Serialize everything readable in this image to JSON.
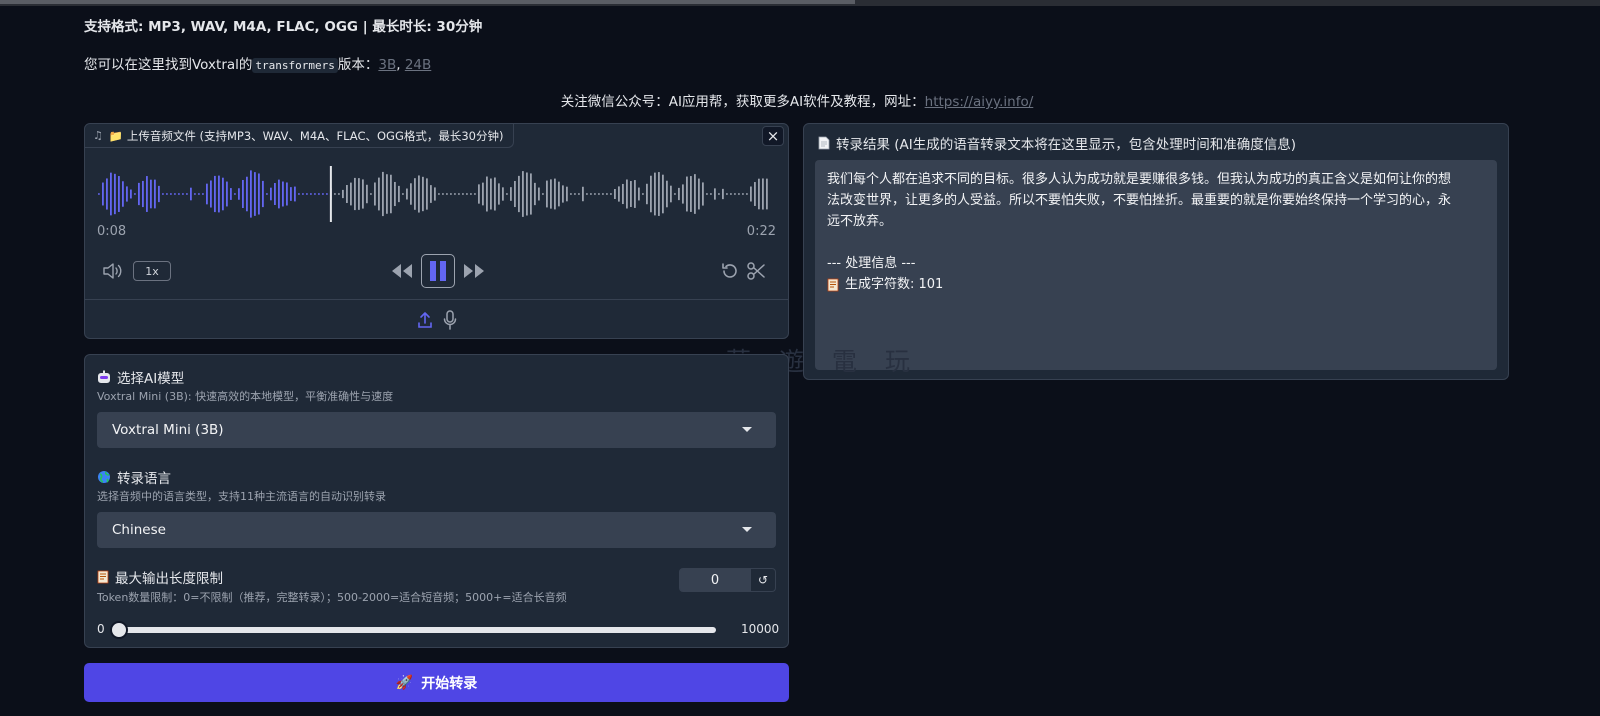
{
  "header": {
    "formats_text": "支持格式: MP3, WAV, M4A, FLAC, OGG | 最长时长: 30分钟",
    "find_prefix": "您可以在这里找到Voxtral的",
    "find_code": "transformers",
    "find_mid": "版本：",
    "link_3b": "3B",
    "link_sep": ", ",
    "link_24b": "24B",
    "follow_text": "关注微信公众号：AI应用帮，获取更多AI软件及教程，网址：",
    "follow_link": "https://aiyy.info/"
  },
  "audio": {
    "label": "📁 上传音频文件 (支持MP3、WAV、M4A、FLAC、OGG格式，最长30分钟)",
    "close": "×",
    "current_time": "0:08",
    "duration": "0:22",
    "speed": "1x",
    "progress": 0.345,
    "colors": {
      "played": "#6366f1",
      "unplayed": "#9ca3af",
      "accent": "#6366f1"
    }
  },
  "result": {
    "title": "转录结果 (AI生成的语音转录文本将在这里显示，包含处理时间和准确度信息)",
    "lines": [
      "我们每个人都在追求不同的目标。很多人认为成功就是要赚很多钱。但我认为成功的真正含义是如何让你的想",
      "法改变世界，让更多的人受益。所以不要怕失败，不要怕挫折。最重要的就是你要始终保持一个学习的心，永",
      "远不放弃。"
    ],
    "info_header": "--- 处理信息 ---",
    "char_count": "生成字符数: 101"
  },
  "watermark": "夢 遊 電 玩",
  "model": {
    "title": "选择AI模型",
    "desc": "Voxtral Mini (3B): 快速高效的本地模型，平衡准确性与速度",
    "selected": "Voxtral Mini (3B)"
  },
  "language": {
    "title": "转录语言",
    "desc": "选择音频中的语言类型，支持11种主流语言的自动识别转录",
    "selected": "Chinese"
  },
  "max_tokens": {
    "title": "最大输出长度限制",
    "desc": "Token数量限制：0=不限制（推荐，完整转录）；500-2000=适合短音频；5000+=适合长音频",
    "value": "0",
    "reset": "↺",
    "min": "0",
    "max": "10000"
  },
  "submit": {
    "icon": "🚀",
    "label": "开始转录",
    "color": "#4f46e5"
  }
}
